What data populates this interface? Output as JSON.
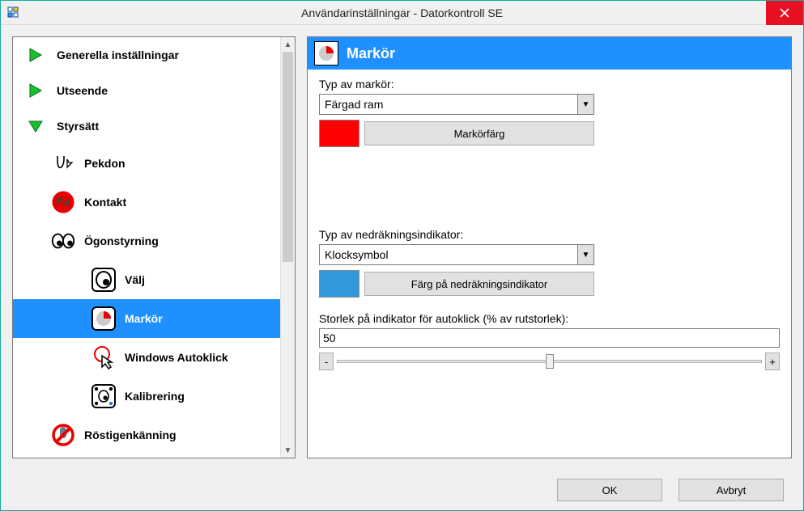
{
  "window": {
    "title": "Användarinställningar - Datorkontroll SE"
  },
  "nav": {
    "items": [
      {
        "label": "Generella inställningar"
      },
      {
        "label": "Utseende"
      },
      {
        "label": "Styrsätt"
      },
      {
        "label": "Pekdon"
      },
      {
        "label": "Kontakt"
      },
      {
        "label": "Ögonstyrning"
      },
      {
        "label": "Välj"
      },
      {
        "label": "Markör"
      },
      {
        "label": "Windows Autoklick"
      },
      {
        "label": "Kalibrering"
      },
      {
        "label": "Röstigenkänning"
      }
    ]
  },
  "panel": {
    "title": "Markör",
    "cursor_type_label": "Typ av markör:",
    "cursor_type_value": "Färgad ram",
    "cursor_color_button": "Markörfärg",
    "cursor_color": "#ff0000",
    "countdown_type_label": "Typ av nedräkningsindikator:",
    "countdown_type_value": "Klocksymbol",
    "countdown_color_button": "Färg på nedräkningsindikator",
    "countdown_color": "#3399dd",
    "size_label": "Storlek på indikator för autoklick (% av rutstorlek):",
    "size_value": "50",
    "minus": "-",
    "plus": "+"
  },
  "footer": {
    "ok": "OK",
    "cancel": "Avbryt"
  }
}
